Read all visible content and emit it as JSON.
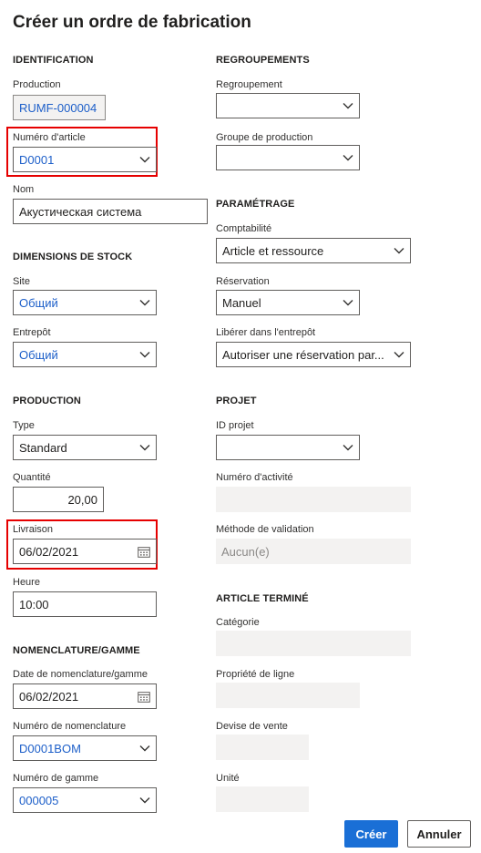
{
  "dialog": {
    "title": "Créer un ordre de fabrication"
  },
  "identification": {
    "heading": "IDENTIFICATION",
    "production_label": "Production",
    "production_value": "RUMF-000004",
    "item_number_label": "Numéro d'article",
    "item_number_value": "D0001",
    "name_label": "Nom",
    "name_value": "Акустическая система"
  },
  "stock_dimensions": {
    "heading": "DIMENSIONS DE STOCK",
    "site_label": "Site",
    "site_value": "Общий",
    "warehouse_label": "Entrepôt",
    "warehouse_value": "Общий"
  },
  "production": {
    "heading": "PRODUCTION",
    "type_label": "Type",
    "type_value": "Standard",
    "quantity_label": "Quantité",
    "quantity_value": "20,00",
    "delivery_label": "Livraison",
    "delivery_value": "06/02/2021",
    "time_label": "Heure",
    "time_value": "10:00"
  },
  "bom_route": {
    "heading": "NOMENCLATURE/GAMME",
    "bom_date_label": "Date de nomenclature/gamme",
    "bom_date_value": "06/02/2021",
    "bom_number_label": "Numéro de nomenclature",
    "bom_number_value": "D0001BOM",
    "route_number_label": "Numéro de gamme",
    "route_number_value": "000005"
  },
  "groupings": {
    "heading": "REGROUPEMENTS",
    "grouping_label": "Regroupement",
    "grouping_value": "",
    "production_group_label": "Groupe de production",
    "production_group_value": ""
  },
  "settings": {
    "heading": "PARAMÉTRAGE",
    "accounting_label": "Comptabilité",
    "accounting_value": "Article et ressource",
    "reservation_label": "Réservation",
    "reservation_value": "Manuel",
    "release_label": "Libérer dans l'entrepôt",
    "release_value": "Autoriser une réservation par..."
  },
  "project": {
    "heading": "PROJET",
    "project_id_label": "ID projet",
    "project_id_value": "",
    "activity_label": "Numéro d'activité",
    "activity_value": "",
    "validation_label": "Méthode de validation",
    "validation_value": "Aucun(e)"
  },
  "finished_item": {
    "heading": "ARTICLE TERMINÉ",
    "category_label": "Catégorie",
    "category_value": "",
    "line_property_label": "Propriété de ligne",
    "line_property_value": "",
    "sales_currency_label": "Devise de vente",
    "sales_currency_value": "",
    "unit_label": "Unité",
    "unit_value": ""
  },
  "actions": {
    "create_label": "Créer",
    "cancel_label": "Annuler"
  },
  "icons": {
    "dropdown": "chevron-down-icon",
    "date": "calendar-icon"
  },
  "colors": {
    "primary": "#1a6fd6",
    "link": "#1d5fc9",
    "highlight": "#e60000",
    "readonly_bg": "#f3f2f1"
  }
}
